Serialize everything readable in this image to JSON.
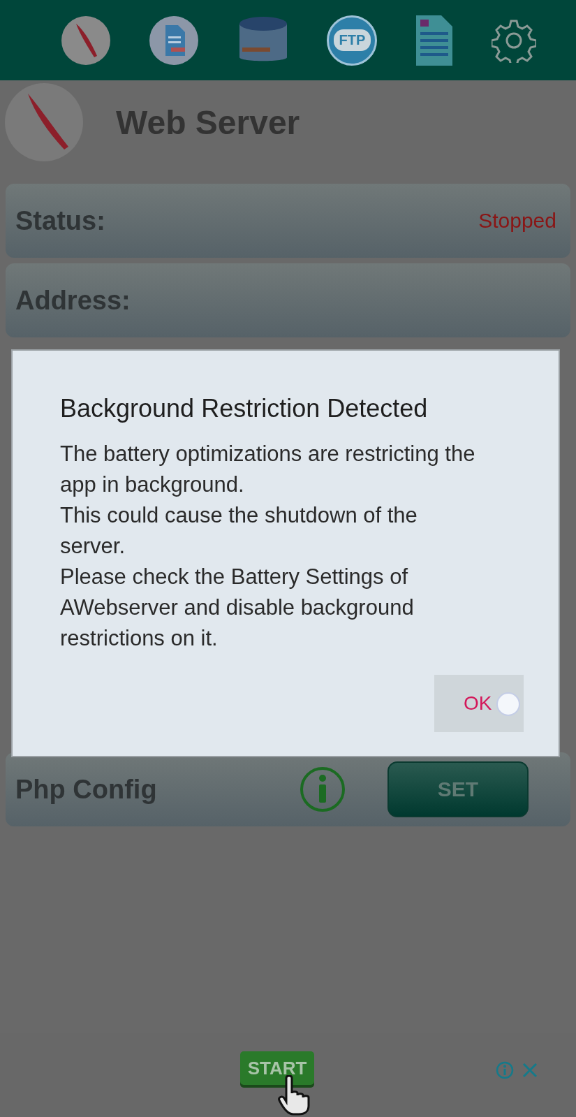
{
  "toolbar": {
    "ftp_label": "FTP"
  },
  "header": {
    "title": "Web Server"
  },
  "fields": [
    {
      "kind": "info",
      "label": "Status:",
      "value": "Stopped"
    },
    {
      "kind": "info",
      "label": "Address:"
    },
    {
      "kind": "action",
      "label": "Php Config",
      "button": "SET"
    }
  ],
  "dialog": {
    "title": "Background Restriction Detected",
    "message": "The battery optimizations are restricting the app in background.\nThis could cause the shutdown of the server.\nPlease check the Battery Settings of AWebserver and disable background restrictions on it.",
    "button": "OK"
  },
  "ad": {
    "button": "START"
  }
}
